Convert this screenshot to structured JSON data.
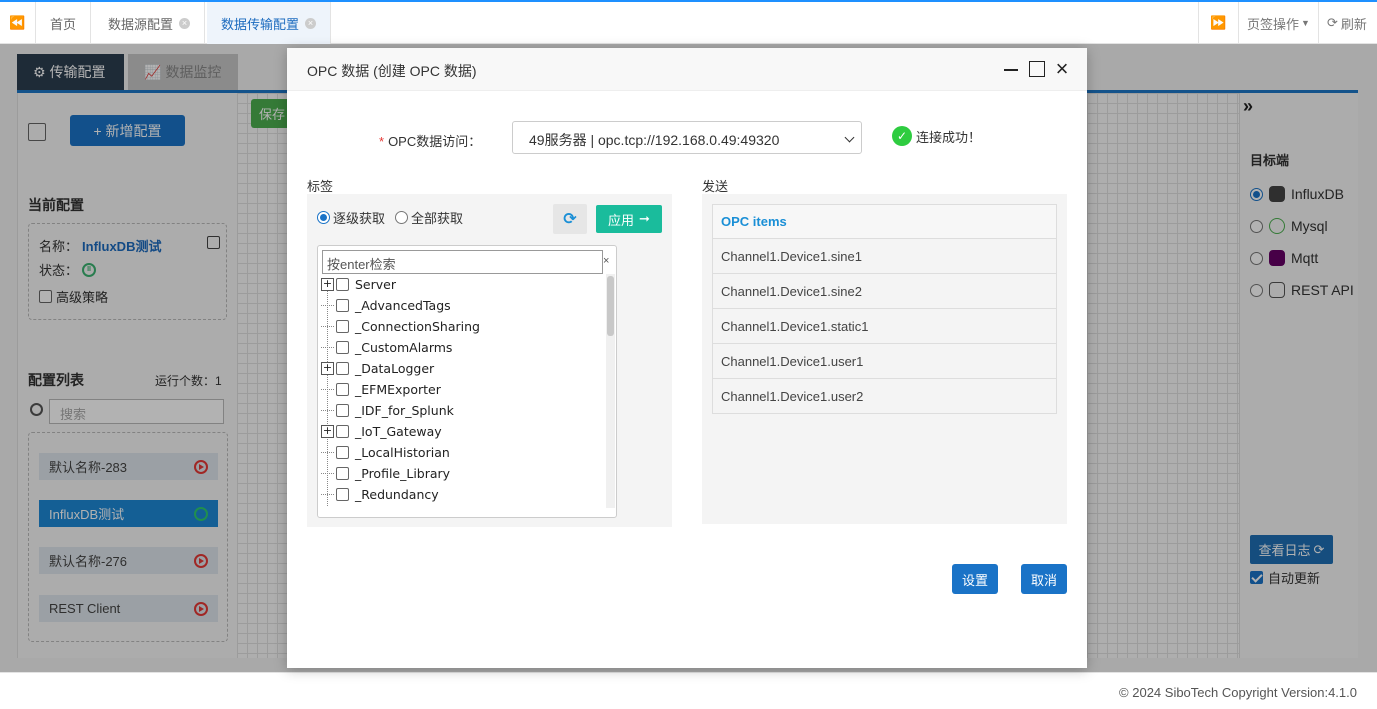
{
  "topbar": {
    "tabs": [
      {
        "label": "首页"
      },
      {
        "label": "数据源配置"
      },
      {
        "label": "数据传输配置"
      }
    ],
    "tab_ops_label": "页签操作",
    "refresh_label": "刷新"
  },
  "background": {
    "tabs": [
      "传输配置",
      "数据监控"
    ],
    "add_config_label": "+ 新增配置",
    "current_config_heading": "当前配置",
    "name_label": "名称：",
    "name_value": "InfluxDB测试",
    "status_label": "状态：",
    "advanced_label": "高级策略",
    "config_list_heading": "配置列表",
    "running_count": "运行个数：1",
    "search_placeholder": "搜索",
    "config_items": [
      {
        "label": "默认名称-283",
        "active": false
      },
      {
        "label": "InfluxDB测试",
        "active": true
      },
      {
        "label": "默认名称-276",
        "active": false
      },
      {
        "label": "REST Client",
        "active": false
      }
    ],
    "save_label": "保存",
    "target_heading": "目标端",
    "targets": [
      {
        "label": "InfluxDB",
        "selected": true,
        "color": "#444444"
      },
      {
        "label": "Mysql",
        "selected": false,
        "color": "#4caf50"
      },
      {
        "label": "Mqtt",
        "selected": false,
        "color": "#660066"
      },
      {
        "label": "REST API",
        "selected": false,
        "color": "#555555"
      }
    ],
    "view_log_label": "查看日志",
    "auto_update_label": "自动更新"
  },
  "modal": {
    "title": "OPC 数据 (创建 OPC 数据)",
    "field_label": "OPC数据访问：",
    "server_value": "49服务器 | opc.tcp://192.168.0.49:49320",
    "connection_status": "连接成功！",
    "tag_section_label": "标签",
    "send_section_label": "发送",
    "radio_options": [
      {
        "label": "逐级获取",
        "selected": true
      },
      {
        "label": "全部获取",
        "selected": false
      }
    ],
    "apply_label": "应用",
    "tree_search_value": "按enter检索",
    "tree_nodes": [
      {
        "label": "Server",
        "expandable": true
      },
      {
        "label": "_AdvancedTags",
        "expandable": false
      },
      {
        "label": "_ConnectionSharing",
        "expandable": false
      },
      {
        "label": "_CustomAlarms",
        "expandable": false
      },
      {
        "label": "_DataLogger",
        "expandable": true
      },
      {
        "label": "_EFMExporter",
        "expandable": false
      },
      {
        "label": "_IDF_for_Splunk",
        "expandable": false
      },
      {
        "label": "_IoT_Gateway",
        "expandable": true
      },
      {
        "label": "_LocalHistorian",
        "expandable": false
      },
      {
        "label": "_Profile_Library",
        "expandable": false
      },
      {
        "label": "_Redundancy",
        "expandable": false
      }
    ],
    "items_header": "OPC items",
    "items": [
      "Channel1.Device1.sine1",
      "Channel1.Device1.sine2",
      "Channel1.Device1.static1",
      "Channel1.Device1.user1",
      "Channel1.Device1.user2"
    ],
    "set_label": "设置",
    "cancel_label": "取消"
  },
  "footer": {
    "text": "© 2024 SiboTech Copyright   Version:4.1.0"
  },
  "colors": {
    "primary": "#1a73c7",
    "success": "#2ecc40",
    "apply": "#1abc9c",
    "accent_blue_text": "#1a8fd6"
  }
}
